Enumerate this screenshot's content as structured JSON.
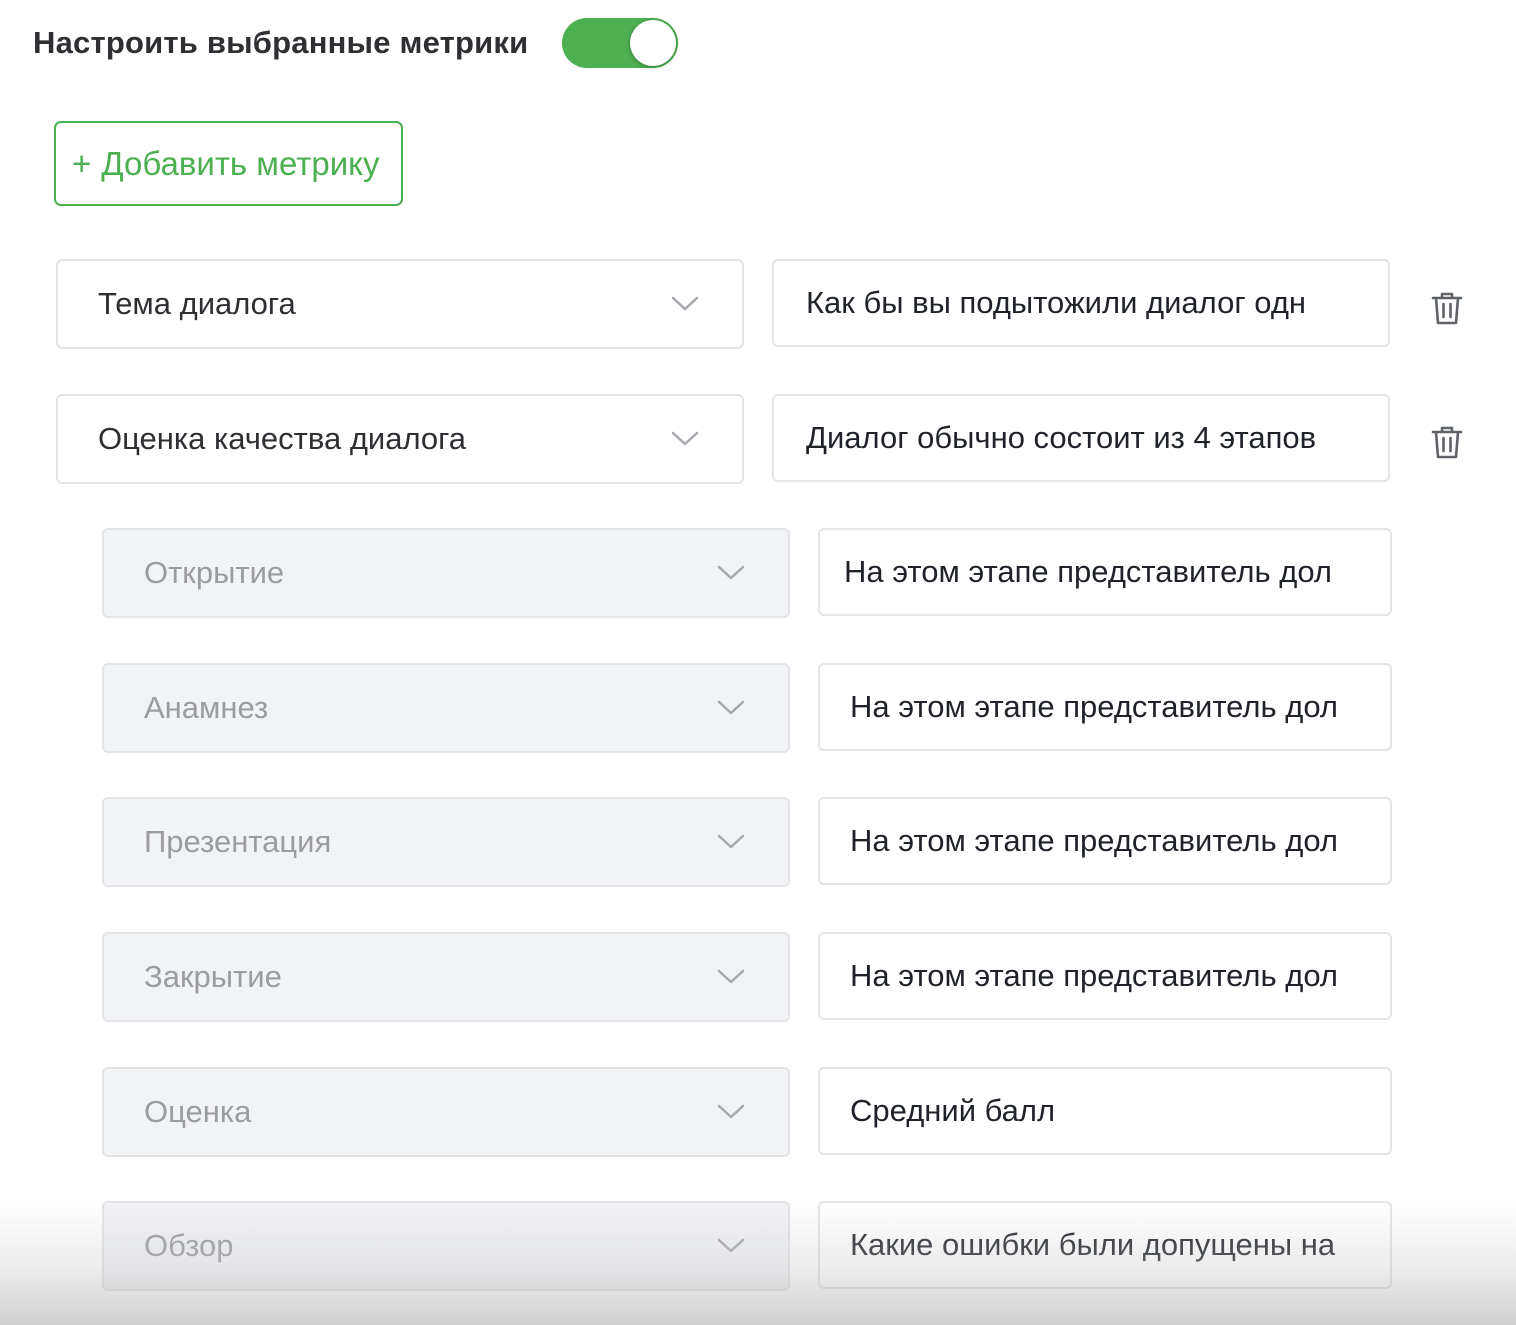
{
  "header": {
    "title": "Настроить выбранные метрики",
    "toggle_on": true,
    "accent_color": "#4caf50"
  },
  "add_button": {
    "plus": "+",
    "label": "Добавить метрику"
  },
  "metrics": [
    {
      "name": "Тема диалога",
      "prompt": "Как бы вы подытожили диалог одн",
      "deletable": true,
      "sub": false
    },
    {
      "name": "Оценка качества диалога",
      "prompt": "Диалог обычно состоит из 4 этапов",
      "deletable": true,
      "sub": false
    },
    {
      "name": "Открытие",
      "prompt": "На этом этапе представитель дол",
      "deletable": false,
      "sub": true
    },
    {
      "name": "Анамнез",
      "prompt": "На этом этапе представитель дол",
      "deletable": false,
      "sub": true
    },
    {
      "name": "Презентация",
      "prompt": "На этом этапе представитель дол",
      "deletable": false,
      "sub": true
    },
    {
      "name": "Закрытие",
      "prompt": "На этом этапе представитель дол",
      "deletable": false,
      "sub": true
    },
    {
      "name": "Оценка",
      "prompt": "Средний балл",
      "deletable": false,
      "sub": true
    },
    {
      "name": "Обзор",
      "prompt": "Какие ошибки были допущены на",
      "deletable": false,
      "sub": true
    }
  ],
  "icons": {
    "dropdown": "chevron-down-icon",
    "delete": "trash-icon"
  }
}
